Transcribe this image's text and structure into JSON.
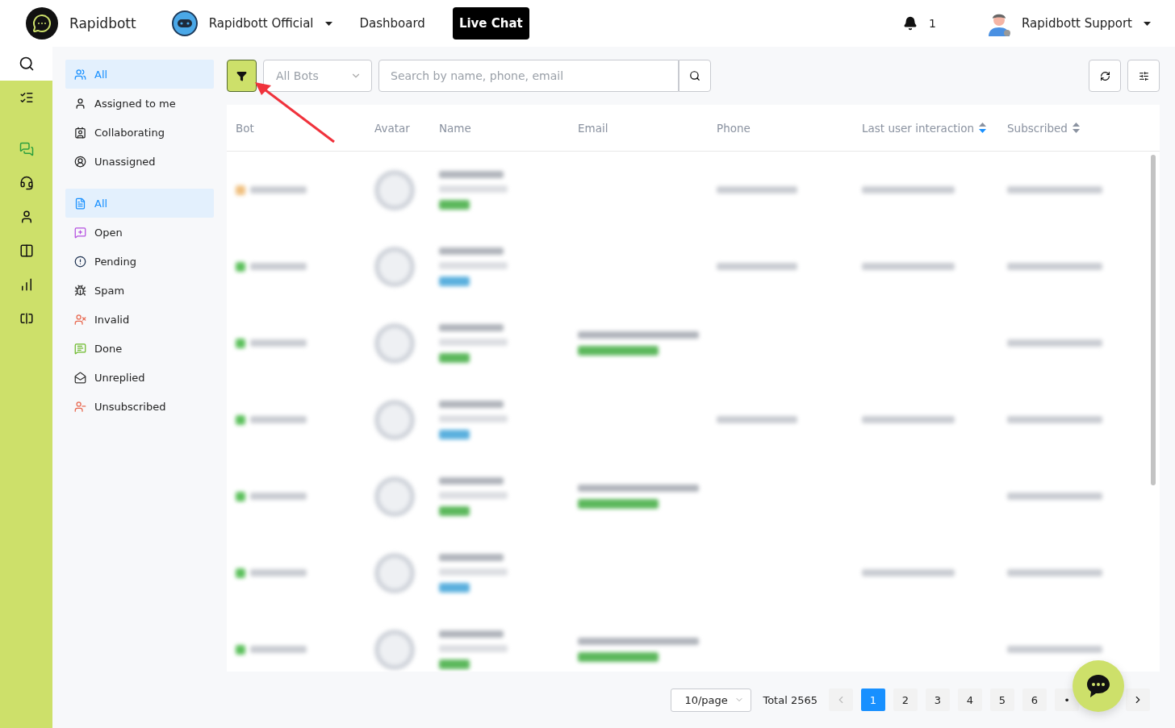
{
  "header": {
    "brand": "Rapidbott",
    "workspace": "Rapidbott Official",
    "nav": [
      {
        "label": "Dashboard",
        "selected": false
      },
      {
        "label": "Live Chat",
        "selected": true
      }
    ],
    "notifications": "1",
    "user": "Rapidbott Support"
  },
  "rail": [
    {
      "kind": "search"
    },
    {
      "kind": "tasks"
    },
    {
      "kind": "chats"
    },
    {
      "kind": "support"
    },
    {
      "kind": "contacts"
    },
    {
      "kind": "board"
    },
    {
      "kind": "analytics"
    },
    {
      "kind": "widget"
    }
  ],
  "assignment_filters": [
    {
      "label": "All",
      "selected": true
    },
    {
      "label": "Assigned to me",
      "selected": false
    },
    {
      "label": "Collaborating",
      "selected": false
    },
    {
      "label": "Unassigned",
      "selected": false
    }
  ],
  "status_filters": [
    {
      "label": "All",
      "selected": true
    },
    {
      "label": "Open",
      "selected": false
    },
    {
      "label": "Pending",
      "selected": false
    },
    {
      "label": "Spam",
      "selected": false
    },
    {
      "label": "Invalid",
      "selected": false
    },
    {
      "label": "Done",
      "selected": false
    },
    {
      "label": "Unreplied",
      "selected": false
    },
    {
      "label": "Unsubscribed",
      "selected": false
    }
  ],
  "toolbar": {
    "filter_active": true,
    "bot_select": "All Bots",
    "search": {
      "placeholder": "Search by name, phone, email"
    }
  },
  "table": {
    "columns": [
      {
        "label": "Bot",
        "kind": "plain"
      },
      {
        "label": "Avatar",
        "kind": "plain"
      },
      {
        "label": "Name",
        "kind": "plain"
      },
      {
        "label": "Email",
        "kind": "plain"
      },
      {
        "label": "Phone",
        "kind": "plain"
      },
      {
        "label": "Last user interaction",
        "kind": "sortable",
        "sorted": true
      },
      {
        "label": "Subscribed",
        "kind": "sortable",
        "sorted": false
      }
    ],
    "rows": [
      {
        "color": "#5cb85c",
        "has_email": false,
        "has_phone": true,
        "has_last_interaction": true
      },
      {
        "color": "#5bb0de",
        "has_email": false,
        "has_phone": true,
        "has_last_interaction": true
      },
      {
        "color": "#5cb85c",
        "has_email": true,
        "has_phone": false,
        "has_last_interaction": false
      },
      {
        "color": "#5bb0de",
        "has_email": false,
        "has_phone": true,
        "has_last_interaction": true
      },
      {
        "color": "#5cb85c",
        "has_email": true,
        "has_phone": false,
        "has_last_interaction": false
      },
      {
        "color": "#5bb0de",
        "has_email": false,
        "has_phone": false,
        "has_last_interaction": true
      },
      {
        "color": "#5cb85c",
        "has_email": true,
        "has_phone": false,
        "has_last_interaction": false
      }
    ]
  },
  "pagination": {
    "page_size": "10/page",
    "total": "Total 2565",
    "prev_disabled": true,
    "pages": [
      {
        "label": "1",
        "selected": true
      },
      {
        "label": "2",
        "selected": false
      },
      {
        "label": "3",
        "selected": false
      },
      {
        "label": "4",
        "selected": false
      },
      {
        "label": "5",
        "selected": false
      },
      {
        "label": "6",
        "selected": false
      }
    ],
    "more": "•"
  }
}
